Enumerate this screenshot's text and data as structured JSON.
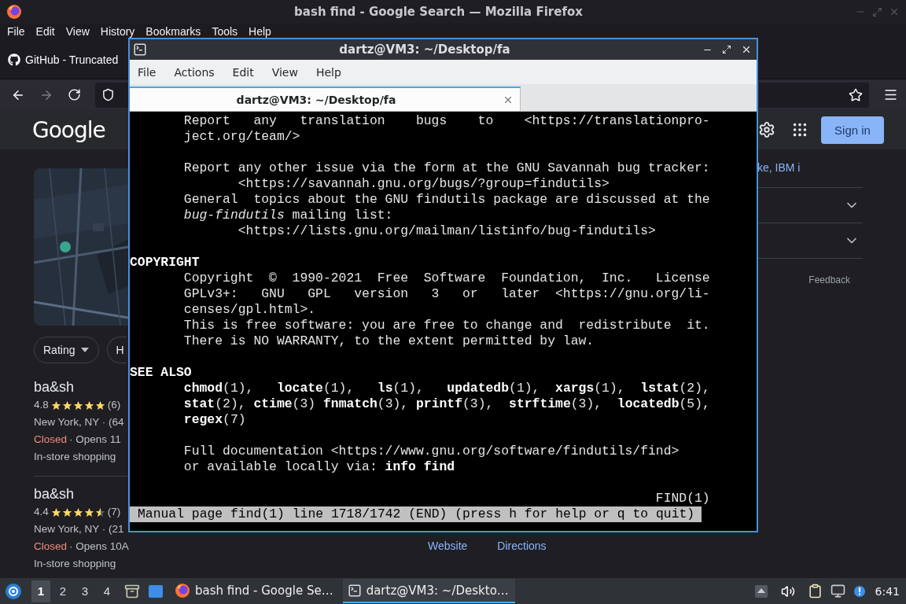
{
  "firefox": {
    "title": "bash find - Google Search — Mozilla Firefox",
    "menu": [
      "File",
      "Edit",
      "View",
      "History",
      "Bookmarks",
      "Tools",
      "Help"
    ],
    "tab": {
      "label": "GitHub - Truncated"
    },
    "google": {
      "logo": "Google",
      "sign_in": "Sign in",
      "filters": [
        "Rating",
        "H"
      ],
      "listings": [
        {
          "name": "ba&sh",
          "rating": "4.8",
          "stars": 5,
          "count": "(6)",
          "address": "New York, NY · (64",
          "status": "Closed",
          "hours": "· Opens 11",
          "tag": "In-store shopping"
        },
        {
          "name": "ba&sh",
          "rating": "4.4",
          "stars": 4.5,
          "count": "(7)",
          "address": "New York, NY · (21",
          "status": "Closed",
          "hours": "· Opens 10A",
          "tag": "In-store shopping"
        }
      ],
      "side_link": "ke, IBM i",
      "feedback": "Feedback",
      "actions": [
        "Website",
        "Directions"
      ]
    }
  },
  "terminal": {
    "title": "dartz@VM3: ~/Desktop/fa",
    "menu": [
      "File",
      "Actions",
      "Edit",
      "View",
      "Help"
    ],
    "tab": {
      "label": "dartz@VM3: ~/Desktop/fa"
    },
    "blocks": [
      [
        "       Report   any   translation    bugs    to    <https://translationpro‐",
        "       ject.org/team/>"
      ],
      [
        "       Report any other issue via the form at the GNU Savannah bug tracker:",
        "              <https://savannah.gnu.org/bugs/?group=findutils>",
        "       General  topics about the GNU findutils package are discussed at the",
        "       *bug-findutils* mailing list:",
        "              <https://lists.gnu.org/mailman/listinfo/bug-findutils>"
      ],
      [
        "**COPYRIGHT**",
        "       Copyright  ©  1990-2021  Free  Software  Foundation,  Inc.   License",
        "       GPLv3+:   GNU   GPL   version   3   or   later  <https://gnu.org/li‐",
        "       censes/gpl.html>.",
        "       This is free software: you are free to change and  redistribute  it.",
        "       There is NO WARRANTY, to the extent permitted by law."
      ],
      [
        "**SEE ALSO**",
        "       **chmod**(1),   **locate**(1),   **ls**(1),   **updatedb**(1),  **xargs**(1),  **lstat**(2),",
        "       **stat**(2), **ctime**(3) **fnmatch**(3), **printf**(3),  **strftime**(3),  **locatedb**(5),",
        "       **regex**(7)"
      ],
      [
        "       Full documentation <https://www.gnu.org/software/findutils/find>",
        "       or available locally via: **info find**"
      ],
      [
        "                                                                    FIND(1)"
      ]
    ],
    "status_line": "Manual page find(1) line 1718/1742 (END) (press h for help or q to quit)"
  },
  "taskbar": {
    "workspaces": [
      {
        "label": "1",
        "selected": true
      },
      {
        "label": "2",
        "selected": false
      },
      {
        "label": "3",
        "selected": false
      },
      {
        "label": "4",
        "selected": false
      }
    ],
    "tasks": [
      {
        "kind": "browser",
        "label": "bash find - Google Se…",
        "selected": false
      },
      {
        "kind": "terminal",
        "label": "dartz@VM3: ~/Deskto…",
        "selected": true
      }
    ],
    "clock": "6:41"
  }
}
